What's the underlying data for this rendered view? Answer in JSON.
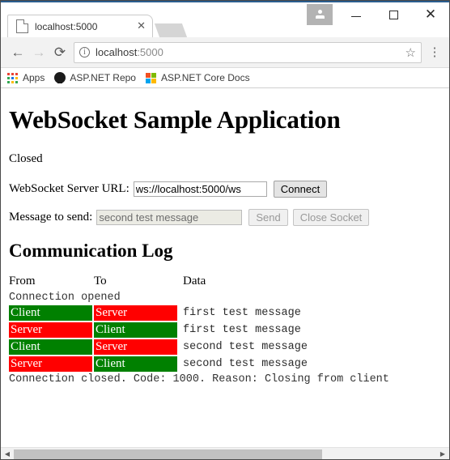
{
  "browser": {
    "window_controls": {
      "profile": "profile-icon",
      "minimize": "—",
      "maximize": "□",
      "close": "✕"
    },
    "tab": {
      "title": "localhost:5000",
      "close_label": "✕"
    },
    "toolbar": {
      "back": "←",
      "forward": "→",
      "reload": "⟳",
      "info_icon_label": "i",
      "url_host": "localhost",
      "url_port": ":5000",
      "bookmark_star": "☆",
      "menu": "⋮"
    },
    "bookmarks": [
      {
        "label": "Apps",
        "icon": "apps-grid-icon"
      },
      {
        "label": "ASP.NET Repo",
        "icon": "github-icon"
      },
      {
        "label": "ASP.NET Core Docs",
        "icon": "microsoft-icon"
      }
    ],
    "apps_grid_colors": [
      "#ea4335",
      "#ea4335",
      "#ea4335",
      "#34a853",
      "#1a73e8",
      "#fbbc05",
      "#34a853",
      "#fbbc05",
      "#34a853"
    ],
    "microsoft_colors": [
      "#f25022",
      "#7fba00",
      "#00a4ef",
      "#ffb900"
    ]
  },
  "page": {
    "title": "WebSocket Sample Application",
    "status": "Closed",
    "url_row": {
      "label": "WebSocket Server URL:",
      "value": "ws://localhost:5000/ws",
      "button": "Connect"
    },
    "message_row": {
      "label": "Message to send:",
      "value": "second test message",
      "send_button": "Send",
      "close_button": "Close Socket"
    },
    "log": {
      "heading": "Communication Log",
      "columns": [
        "From",
        "To",
        "Data"
      ],
      "rows": [
        {
          "kind": "note",
          "text": "Connection opened"
        },
        {
          "kind": "message",
          "from": "Client",
          "to": "Server",
          "data": "first test message"
        },
        {
          "kind": "message",
          "from": "Server",
          "to": "Client",
          "data": "first test message"
        },
        {
          "kind": "message",
          "from": "Client",
          "to": "Server",
          "data": "second test message"
        },
        {
          "kind": "message",
          "from": "Server",
          "to": "Client",
          "data": "second test message"
        },
        {
          "kind": "note",
          "text": "Connection closed. Code: 1000. Reason: Closing from client"
        }
      ]
    }
  },
  "colors": {
    "client": "#008000",
    "server": "#ff0000"
  },
  "scrollbar": {
    "left_arrow": "◀",
    "right_arrow": "▶"
  }
}
